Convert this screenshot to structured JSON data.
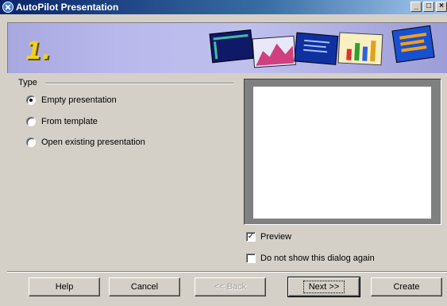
{
  "window": {
    "title": "AutoPilot Presentation",
    "min": "_",
    "max": "□",
    "close": "×"
  },
  "banner": {
    "step": "1."
  },
  "type_group": {
    "label": "Type",
    "options": [
      {
        "label": "Empty presentation",
        "checked": true
      },
      {
        "label": "From template",
        "checked": false
      },
      {
        "label": "Open existing presentation",
        "checked": false
      }
    ]
  },
  "options": {
    "preview": {
      "label": "Preview",
      "checked": true,
      "mark": "✓"
    },
    "dont_show": {
      "label": "Do not show this dialog again",
      "checked": false
    }
  },
  "buttons": {
    "help": "Help",
    "cancel": "Cancel",
    "back": "<< Back",
    "next": "Next >>",
    "create": "Create"
  },
  "colors": {
    "titlebar": "#0a246a",
    "banner": "#b8b8ec",
    "face": "#d4d0c8"
  }
}
